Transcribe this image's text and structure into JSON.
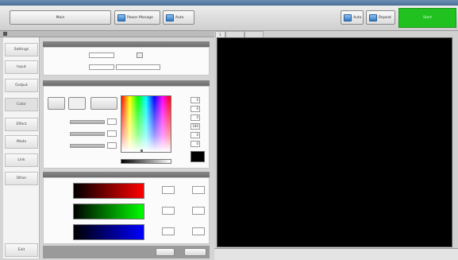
{
  "topbar": {
    "title_tab": "Main",
    "btn_power": "Power Manage",
    "btn_autoconnect": "Auto",
    "btn_auto": "Auto",
    "btn_repeat": "Repeat",
    "btn_start": "Start"
  },
  "sidebar": {
    "items": [
      "Settings",
      "Input",
      "Output",
      "Color",
      "Effect",
      "Mode",
      "Link",
      "Other"
    ],
    "bottom": "Exit"
  },
  "panel1": {
    "header": "",
    "field1_label": "",
    "field1_value": "",
    "field1_suffix": "",
    "field2_label": "",
    "field2_a": "",
    "field2_b": ""
  },
  "panel2": {
    "header": "",
    "mode_a": "",
    "mode_b": "",
    "mode_c": "",
    "picker_label": "",
    "row1_label": "",
    "row2_label": "",
    "row3_label": "",
    "row1_value": "",
    "row2_value": "",
    "row3_value": "",
    "channels": [
      "",
      "",
      "",
      "",
      "",
      ""
    ],
    "channel_values": [
      "0",
      "0",
      "0",
      "180",
      "0",
      "0"
    ],
    "preview_label": ""
  },
  "panel3": {
    "header": "",
    "rows": [
      {
        "label": "",
        "gradient_to": "#ff0000",
        "lo_label": "",
        "hi_label": ""
      },
      {
        "label": "",
        "gradient_to": "#00ff00",
        "lo_label": "",
        "hi_label": ""
      },
      {
        "label": "",
        "gradient_to": "#0000ff",
        "lo_label": "",
        "hi_label": ""
      }
    ]
  },
  "footer": {
    "apply": "",
    "ok": ""
  },
  "viewer": {
    "tab": "1",
    "status": ""
  },
  "colors": {
    "accent_green": "#21c11f",
    "screen_bg": "#000000"
  }
}
